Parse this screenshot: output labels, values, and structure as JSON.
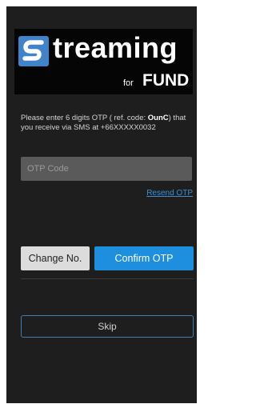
{
  "logo": {
    "word": "treaming",
    "for_text": "for",
    "fund_text": "FUND",
    "icon": "streaming-s-logo-icon"
  },
  "instruction": {
    "prefix": "Please enter 6 digits OTP ( ref. code: ",
    "ref_code": "OunC",
    "suffix": ") that you receive via SMS at +66XXXXX0032"
  },
  "otp": {
    "placeholder": "OTP Code",
    "value": ""
  },
  "resend_label": "Resend OTP",
  "buttons": {
    "change": "Change No.",
    "confirm": "Confirm OTP",
    "skip": "Skip"
  },
  "colors": {
    "background": "#1e1e1e",
    "accent": "#1e8ede",
    "link": "#3a8ed8"
  }
}
